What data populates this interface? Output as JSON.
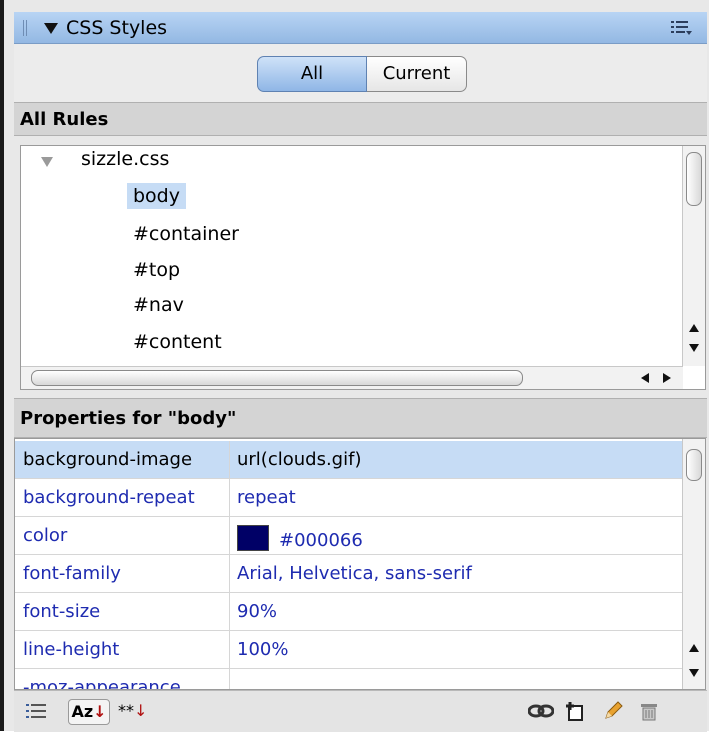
{
  "panel": {
    "title": "CSS Styles"
  },
  "toggle": {
    "all_label": "All",
    "current_label": "Current",
    "selected": "All"
  },
  "rules": {
    "header": "All Rules",
    "stylesheet": "sizzle.css",
    "items": [
      "body",
      "#container",
      "#top",
      "#nav",
      "#content"
    ],
    "selected": "body"
  },
  "properties": {
    "header": "Properties for \"body\"",
    "rows": [
      {
        "name": "background-image",
        "value": "url(clouds.gif)"
      },
      {
        "name": "background-repeat",
        "value": "repeat"
      },
      {
        "name": "color",
        "value": "#000066"
      },
      {
        "name": "font-family",
        "value": "Arial, Helvetica, sans-serif"
      },
      {
        "name": "font-size",
        "value": "90%"
      },
      {
        "name": "line-height",
        "value": "100%"
      },
      {
        "name": "-moz-appearance",
        "value": ""
      }
    ],
    "color_swatch": "#000066"
  },
  "toolbar": {
    "icons": [
      "category-view-icon",
      "alpha-sort-icon",
      "set-properties-icon",
      "attach-stylesheet-icon",
      "new-rule-icon",
      "edit-rule-icon",
      "delete-icon"
    ],
    "az_label": "Az",
    "star_label": "**"
  },
  "colors": {
    "accent": "#93b8e3",
    "selection": "#c6dcf5",
    "property_text": "#1e2bb0"
  }
}
